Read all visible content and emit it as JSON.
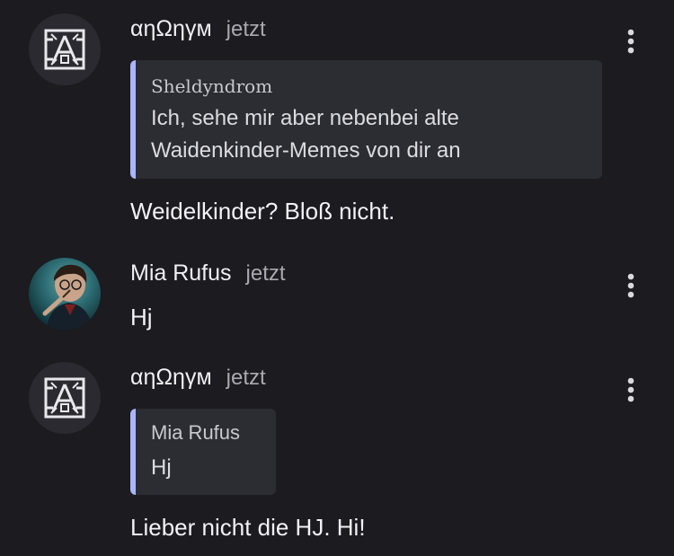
{
  "messages": [
    {
      "author": "αηΩηγм",
      "time": "jetzt",
      "avatar_icon": "maze-logo-icon",
      "quote": {
        "author": "Sheldyndrom",
        "line1": "Ich, sehe mir aber nebenbei alte",
        "line2": "Waidenkinder-Memes von dir an"
      },
      "text": "Weidelkinder? Bloß nicht."
    },
    {
      "author": "Mia Rufus",
      "time": "jetzt",
      "avatar_icon": "profile-photo",
      "text": "Hj"
    },
    {
      "author": "αηΩηγм",
      "time": "jetzt",
      "avatar_icon": "maze-logo-icon",
      "quote": {
        "author": "Mia Rufus",
        "line1": "Hj"
      },
      "text": "Lieber nicht die HJ. Hi!"
    }
  ],
  "colors": {
    "background": "#1b1b20",
    "quote_bg": "#2c2c33",
    "quote_accent": "#a9b5ff",
    "text": "#f3f3f5",
    "muted": "#a9a9b0"
  }
}
